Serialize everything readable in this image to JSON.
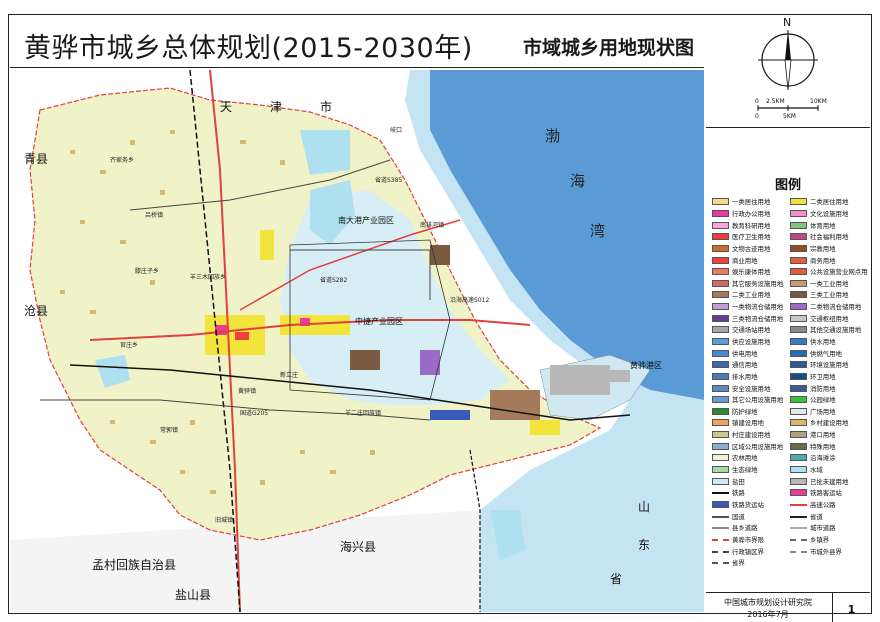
{
  "title": {
    "main": "黄骅市城乡总体规划(2015-2030年)",
    "sub": "市域城乡用地现状图"
  },
  "compass": {
    "north": "N",
    "scale_top_left": "0",
    "scale_top_mid": "2.5KM",
    "scale_top_right": "10KM",
    "scale_bottom_left": "0",
    "scale_bottom_mid": "5KM"
  },
  "legend": {
    "title": "图例",
    "items": [
      {
        "label": "一类居住用地",
        "color": "#f7d98b",
        "kind": "fill"
      },
      {
        "label": "二类居住用地",
        "color": "#f2e43a",
        "kind": "fill"
      },
      {
        "label": "行政办公用地",
        "color": "#e83b9c",
        "kind": "fill"
      },
      {
        "label": "文化设施用地",
        "color": "#f58fc9",
        "kind": "fill"
      },
      {
        "label": "教育科研用地",
        "color": "#f5a9d6",
        "kind": "fill"
      },
      {
        "label": "体育用地",
        "color": "#7fc47f",
        "kind": "fill"
      },
      {
        "label": "医疗卫生用地",
        "color": "#f03c3c",
        "kind": "fill"
      },
      {
        "label": "社会福利用地",
        "color": "#c04a7a",
        "kind": "fill"
      },
      {
        "label": "文物古迹用地",
        "color": "#c96b2b",
        "kind": "fill"
      },
      {
        "label": "宗教用地",
        "color": "#9a4a2a",
        "kind": "fill"
      },
      {
        "label": "商业用地",
        "color": "#f04040",
        "kind": "fill"
      },
      {
        "label": "商务用地",
        "color": "#e0603a",
        "kind": "fill"
      },
      {
        "label": "娱乐康体用地",
        "color": "#f07a5a",
        "kind": "fill"
      },
      {
        "label": "公共设施营业网点用地",
        "color": "#e05a40",
        "kind": "fill"
      },
      {
        "label": "其它服务设施用地",
        "color": "#d06a6a",
        "kind": "fill"
      },
      {
        "label": "一类工业用地",
        "color": "#c59a7a",
        "kind": "fill"
      },
      {
        "label": "二类工业用地",
        "color": "#a57a5a",
        "kind": "fill"
      },
      {
        "label": "三类工业用地",
        "color": "#7a5a40",
        "kind": "fill"
      },
      {
        "label": "一类物流仓储用地",
        "color": "#c49ad8",
        "kind": "fill"
      },
      {
        "label": "二类物流仓储用地",
        "color": "#9a6ac8",
        "kind": "fill"
      },
      {
        "label": "三类物流仓储用地",
        "color": "#6a3a9a",
        "kind": "fill"
      },
      {
        "label": "交通枢纽用地",
        "color": "#c8c8c8",
        "kind": "fill"
      },
      {
        "label": "交通场站用地",
        "color": "#a8a8a8",
        "kind": "fill"
      },
      {
        "label": "其他交通设施用地",
        "color": "#8a8a8a",
        "kind": "fill"
      },
      {
        "label": "供应设施用地",
        "color": "#5aa0d8",
        "kind": "fill"
      },
      {
        "label": "供水用地",
        "color": "#3a7ac0",
        "kind": "fill"
      },
      {
        "label": "供电用地",
        "color": "#4a8ad0",
        "kind": "fill"
      },
      {
        "label": "供燃气用地",
        "color": "#2a6ab0",
        "kind": "fill"
      },
      {
        "label": "通信用地",
        "color": "#3a6aa8",
        "kind": "fill"
      },
      {
        "label": "环境设施用地",
        "color": "#2a5a98",
        "kind": "fill"
      },
      {
        "label": "排水用地",
        "color": "#4a7ab8",
        "kind": "fill"
      },
      {
        "label": "环卫用地",
        "color": "#1a4a88",
        "kind": "fill"
      },
      {
        "label": "安全设施用地",
        "color": "#5a8ac8",
        "kind": "fill"
      },
      {
        "label": "消防用地",
        "color": "#3a5a98",
        "kind": "fill"
      },
      {
        "label": "其它公用设施用地",
        "color": "#6a9ad0",
        "kind": "fill"
      },
      {
        "label": "公园绿地",
        "color": "#3cc03c",
        "kind": "fill"
      },
      {
        "label": "防护绿地",
        "color": "#2a8a2a",
        "kind": "fill"
      },
      {
        "label": "广场用地",
        "color": "#e8e8e8",
        "kind": "fill"
      },
      {
        "label": "镇建设用地",
        "color": "#f0a060",
        "kind": "fill"
      },
      {
        "label": "乡村建设用地",
        "color": "#d8b870",
        "kind": "fill"
      },
      {
        "label": "村庄建设用地",
        "color": "#c8c890",
        "kind": "fill"
      },
      {
        "label": "港口用地",
        "color": "#b0a080",
        "kind": "fill"
      },
      {
        "label": "区域公用设施用地",
        "color": "#8ab0d0",
        "kind": "fill"
      },
      {
        "label": "特殊用地",
        "color": "#6a6a4a",
        "kind": "fill"
      },
      {
        "label": "农林用地",
        "color": "#f0f2c8",
        "kind": "fill"
      },
      {
        "label": "沿海滩涂",
        "color": "#5aa8a8",
        "kind": "fill"
      },
      {
        "label": "生态绿地",
        "color": "#a8d8a0",
        "kind": "fill"
      },
      {
        "label": "水域",
        "color": "#aee0f0",
        "kind": "fill"
      },
      {
        "label": "盐田",
        "color": "#cfe8f2",
        "kind": "fill"
      },
      {
        "label": "已批未建用地",
        "color": "#b8b8b8",
        "kind": "fill"
      },
      {
        "label": "铁路",
        "color": "#111111",
        "kind": "line"
      },
      {
        "label": "铁路客运站",
        "color": "#e83b9c",
        "kind": "fill"
      },
      {
        "label": "铁路货运站",
        "color": "#3a5ab8",
        "kind": "fill"
      },
      {
        "label": "高速公路",
        "color": "#e04040",
        "kind": "line"
      },
      {
        "label": "国道",
        "color": "#555555",
        "kind": "line"
      },
      {
        "label": "省道",
        "color": "#222222",
        "kind": "line"
      },
      {
        "label": "县乡道路",
        "color": "#888888",
        "kind": "line"
      },
      {
        "label": "城市道路",
        "color": "#aaaaaa",
        "kind": "line"
      },
      {
        "label": "黄骅市界限",
        "color": "#e04040",
        "kind": "dash"
      },
      {
        "label": "乡镇界",
        "color": "#666666",
        "kind": "dash"
      },
      {
        "label": "行政镇区界",
        "color": "#444444",
        "kind": "dash"
      },
      {
        "label": "市城外县界",
        "color": "#888888",
        "kind": "dash"
      },
      {
        "label": "省界",
        "color": "#555555",
        "kind": "dash"
      }
    ]
  },
  "footer": {
    "org": "中国城市规划设计研究院",
    "date": "2016年7月",
    "page": "1"
  },
  "map_labels": {
    "tianjin_1": "天",
    "tianjin_2": "津",
    "tianjin_3": "市",
    "bo": "渤",
    "hai": "海",
    "wan": "湾",
    "qingxian": "青县",
    "cangxian": "沧县",
    "mengcun": "孟村回族自治县",
    "yanshan": "盐山县",
    "haixing": "海兴县",
    "shan": "山",
    "dong": "东",
    "sheng": "省",
    "nandagang": "南大港产业园区",
    "zhongjie": "中捷产业园区",
    "huanghua_port": "黄骅港区",
    "town_qijiawu": "齐家务乡",
    "town_lvqiao": "吕桥镇",
    "town_jiuchong": "旧城镇",
    "town_changguo": "常郭镇",
    "town_tengzhuangzi": "滕庄子乡",
    "town_guancheng": "官庄乡",
    "town_yangsanmu": "羊三木回族乡",
    "town_nanpaihe": "南排河镇",
    "town_huanghuazhen": "黄骅镇",
    "town_yangerzhuang": "羊二庄回族镇",
    "town_xinlizhuang": "新立庄",
    "town_qikou": "岐口",
    "road_s385": "省道S385",
    "road_s282": "省道S282",
    "road_g205": "国道G205",
    "road_gaosu": "沿海高速S012"
  }
}
